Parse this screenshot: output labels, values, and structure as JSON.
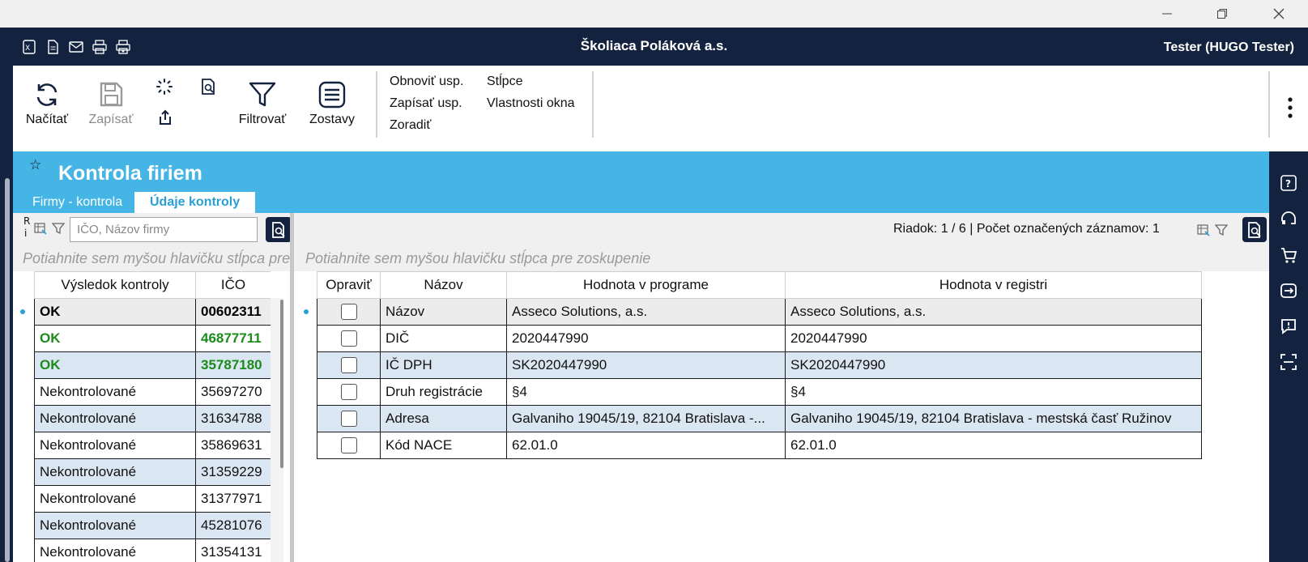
{
  "window": {
    "app_title": "Školiaca Poláková a.s.",
    "user": "Tester (HUGO Tester)",
    "controls": [
      "minimize-icon",
      "maximize-icon",
      "close-icon"
    ]
  },
  "header_icons": [
    "excel-icon",
    "document-icon",
    "mail-icon",
    "print-icon",
    "print-preview-icon"
  ],
  "ribbon": {
    "load_label": "Načítať",
    "save_label": "Zapísať",
    "filter_label": "Filtrovať",
    "reports_label": "Zostavy",
    "links_col1": [
      "Obnoviť usp.",
      "Zapísať usp.",
      "Zoradiť"
    ],
    "links_col2": [
      "Stĺpce",
      "Vlastnosti okna"
    ]
  },
  "page": {
    "title": "Kontrola firiem",
    "tabs": [
      "Firmy - kontrola",
      "Údaje kontroly"
    ],
    "active_tab": "Údaje kontroly"
  },
  "left_panel": {
    "search_placeholder": "IČO, Názov firmy",
    "groupby_hint": "Potiahnite sem myšou hlavičku stĺpca pre zoskupenie",
    "columns": [
      "Výsledok kontroly",
      "IČO"
    ],
    "rows": [
      {
        "result": "OK",
        "ico": "00602311",
        "state": "selected"
      },
      {
        "result": "OK",
        "ico": "46877711",
        "state": "ok"
      },
      {
        "result": "OK",
        "ico": "35787180",
        "state": "ok"
      },
      {
        "result": "Nekontrolované",
        "ico": "35697270",
        "state": "normal"
      },
      {
        "result": "Nekontrolované",
        "ico": "31634788",
        "state": "normal"
      },
      {
        "result": "Nekontrolované",
        "ico": "35869631",
        "state": "normal"
      },
      {
        "result": "Nekontrolované",
        "ico": "31359229",
        "state": "normal"
      },
      {
        "result": "Nekontrolované",
        "ico": "31377971",
        "state": "normal"
      },
      {
        "result": "Nekontrolované",
        "ico": "45281076",
        "state": "normal"
      },
      {
        "result": "Nekontrolované",
        "ico": "31354131",
        "state": "normal"
      }
    ]
  },
  "right_panel": {
    "status": "Riadok: 1 / 6 | Počet označených záznamov: 1",
    "groupby_hint": "Potiahnite sem myšou hlavičku stĺpca pre zoskupenie",
    "columns": [
      "Opraviť",
      "Názov",
      "Hodnota v programe",
      "Hodnota v registri"
    ],
    "rows": [
      {
        "checked": false,
        "name": "Názov",
        "program": "Asseco Solutions, a.s.",
        "registry": "Asseco Solutions, a.s."
      },
      {
        "checked": false,
        "name": "DIČ",
        "program": "2020447990",
        "registry": "2020447990"
      },
      {
        "checked": false,
        "name": "IČ DPH",
        "program": "SK2020447990",
        "registry": "SK2020447990"
      },
      {
        "checked": false,
        "name": "Druh registrácie",
        "program": "§4",
        "registry": "§4"
      },
      {
        "checked": false,
        "name": "Adresa",
        "program": "Galvaniho 19045/19, 82104 Bratislava -...",
        "registry": "Galvaniho 19045/19, 82104 Bratislava - mestská časť Ružinov"
      },
      {
        "checked": false,
        "name": "Kód NACE",
        "program": "62.01.0",
        "registry": "62.01.0"
      }
    ]
  },
  "right_bar_icons": [
    "help-icon",
    "headset-icon",
    "cart-icon",
    "exchange-icon",
    "feedback-icon",
    "scan-icon"
  ],
  "colors": {
    "navy": "#13233f",
    "accent_blue": "#45b5e6",
    "ok_green": "#1b8c1b",
    "row_alt": "#dbe6f3"
  }
}
